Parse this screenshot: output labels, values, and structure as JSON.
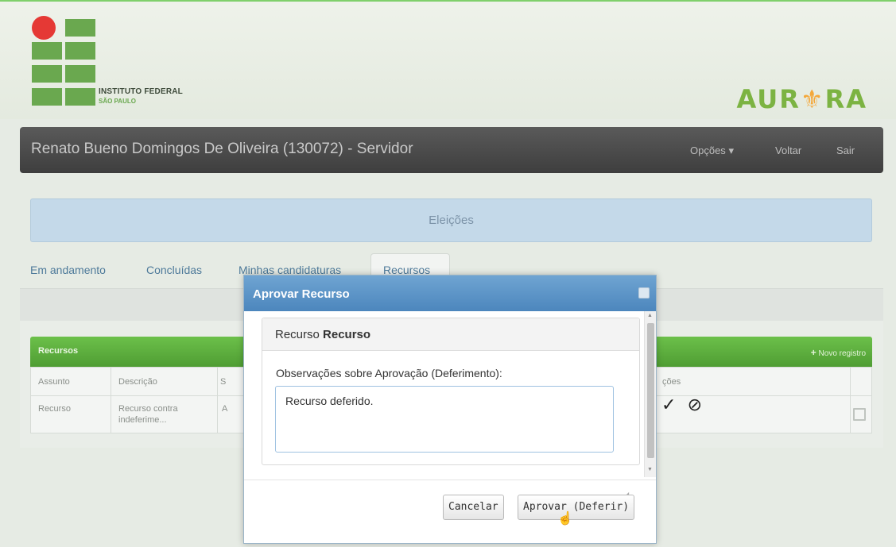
{
  "header": {
    "institution": {
      "name": "INSTITUTO FEDERAL",
      "subtitle": "SÃO PAULO"
    },
    "brand": {
      "left": "AUR",
      "sun": "⚜",
      "right": "RA"
    },
    "colors": {
      "logo_green": "#6aa84f",
      "logo_red": "#e53935",
      "brand_green": "#7cb342",
      "brand_orange": "#f4a83a"
    }
  },
  "navbar": {
    "user": "Renato Bueno Domingos De Oliveira (130072) - Servidor",
    "options_label": "Opções",
    "options_caret": "▾",
    "back_label": "Voltar",
    "logout_label": "Sair"
  },
  "banner": {
    "title": "Eleições"
  },
  "tabs": [
    {
      "label": "Em andamento"
    },
    {
      "label": "Concluídas"
    },
    {
      "label": "Minhas candidaturas"
    },
    {
      "label": "Recursos",
      "active": true
    }
  ],
  "table_panel": {
    "title": "Recursos",
    "new_record_icon": "plus-icon",
    "new_record_label": "Novo registro",
    "columns": [
      "Assunto",
      "Descrição",
      "S",
      "ções"
    ],
    "rows": [
      {
        "assunto": "Recurso",
        "descricao_1": "Recurso contra",
        "descricao_2": "indeferime...",
        "s": "A"
      }
    ],
    "row_actions": {
      "approve_icon": "✓",
      "deny_icon": "⊘"
    }
  },
  "modal": {
    "title": "Aprovar Recurso",
    "panel_title_prefix": "Recurso",
    "panel_title_bold": "Recurso",
    "observations_label": "Observações sobre Aprovação (Deferimento):",
    "observations_value": "Recurso deferido.",
    "cancel_label": "Cancelar",
    "approve_label": "Aprovar (Deferir)"
  }
}
